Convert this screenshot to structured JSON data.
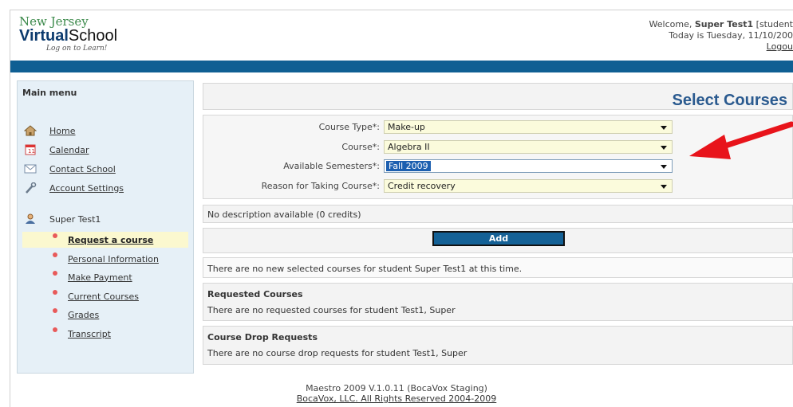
{
  "logo": {
    "line1": "New Jersey",
    "line2a": "Virtual",
    "line2b": "School",
    "tagline": "Log on to Learn!"
  },
  "header": {
    "welcome_prefix": "Welcome,",
    "user": "Super Test1",
    "role": "[student",
    "date": "Today is Tuesday, 11/10/200",
    "logout": "Logou"
  },
  "sidebar": {
    "title": "Main menu",
    "items": [
      {
        "label": "Home",
        "icon": "home-icon"
      },
      {
        "label": "Calendar",
        "icon": "calendar-icon"
      },
      {
        "label": "Contact School",
        "icon": "envelope-icon"
      },
      {
        "label": "Account Settings",
        "icon": "wrench-icon"
      }
    ],
    "user_label": "Super Test1",
    "subitems": [
      {
        "label": "Request a course",
        "active": true
      },
      {
        "label": "Personal Information"
      },
      {
        "label": "Make Payment"
      },
      {
        "label": "Current Courses"
      },
      {
        "label": "Grades"
      },
      {
        "label": "Transcript"
      }
    ]
  },
  "main": {
    "title": "Select Courses",
    "form": [
      {
        "label": "Course Type*:",
        "value": "Make-up"
      },
      {
        "label": "Course*:",
        "value": "Algebra II"
      },
      {
        "label": "Available Semesters*:",
        "value": "Fall 2009"
      },
      {
        "label": "Reason for Taking Course*:",
        "value": "Credit recovery"
      }
    ],
    "description": "No description available (0 credits)",
    "add_label": "Add",
    "no_new": "There are no new selected courses for student Super Test1 at this time.",
    "requested_heading": "Requested Courses",
    "requested_text": "There are no requested courses for student Test1, Super",
    "drop_heading": "Course Drop Requests",
    "drop_text": "There are no course drop requests for student Test1, Super"
  },
  "footer": {
    "line1": "Maestro 2009 V.1.0.11 (BocaVox Staging)",
    "line2": "BocaVox, LLC. All Rights Reserved 2004-2009"
  },
  "colors": {
    "bluebar": "#0f5f93",
    "accent_title": "#2a5a8f",
    "arrow": "#e8141b",
    "active_item": "#fbf8cf"
  }
}
